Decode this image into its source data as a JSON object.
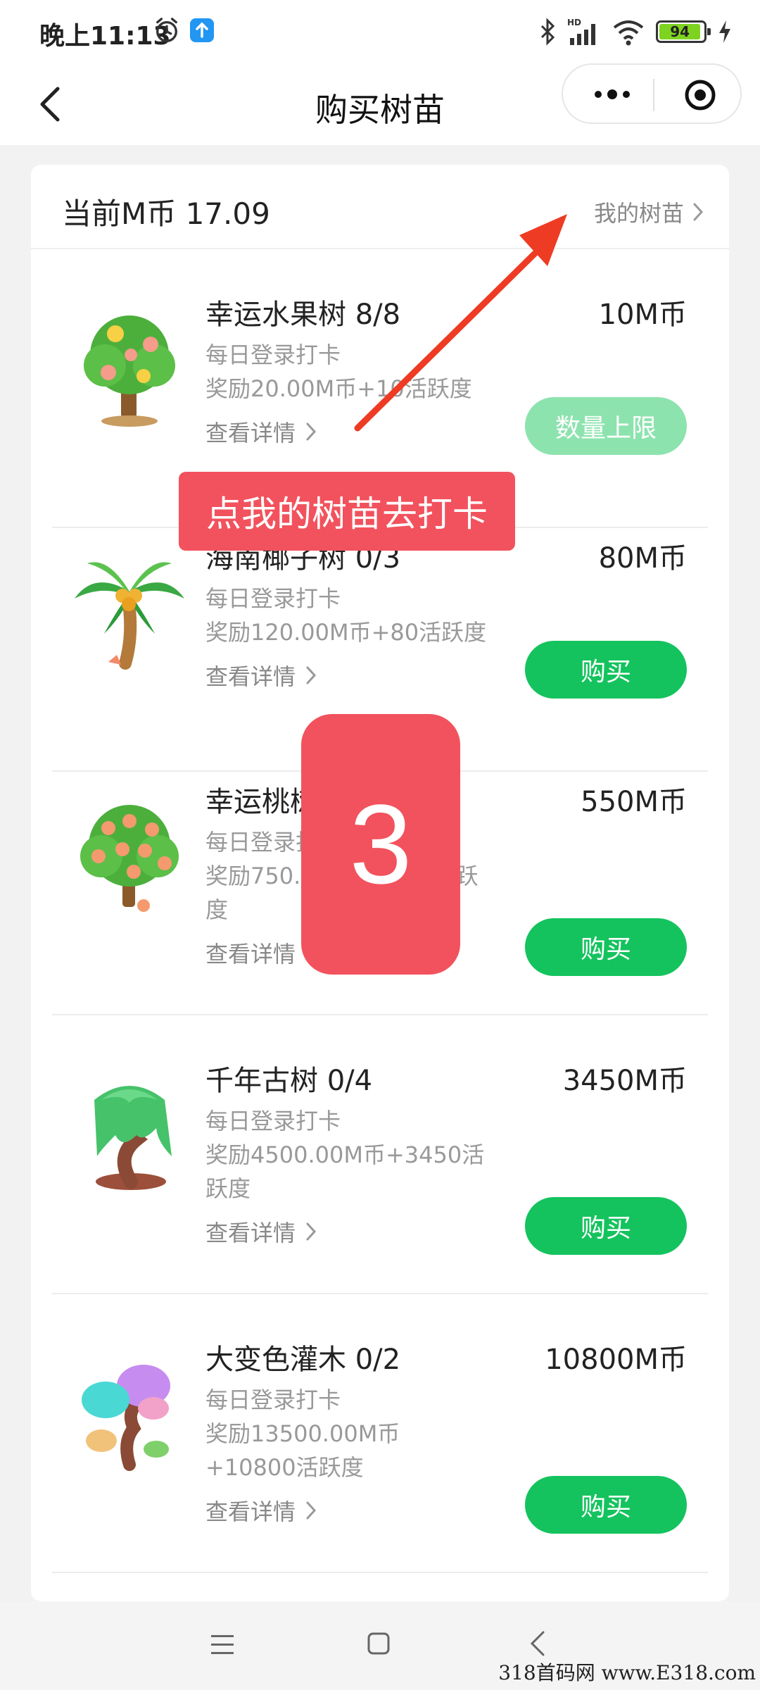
{
  "status_bar": {
    "time": "晚上11:13",
    "battery": "94",
    "network_label": "HD"
  },
  "nav": {
    "title": "购买树苗"
  },
  "header": {
    "balance": "当前M币 17.09",
    "my_trees_link": "我的树苗"
  },
  "items": [
    {
      "name": "幸运水果树 8/8",
      "price": "10M币",
      "desc_line1": "每日登录打卡",
      "desc_line2": "奖励20.00M币+10活跃度",
      "detail": "查看详情",
      "button": "数量上限",
      "disabled": true
    },
    {
      "name": "海南椰子树 0/3",
      "price": "80M币",
      "desc_line1": "每日登录打卡",
      "desc_line2": "奖励120.00M币+80活跃度",
      "detail": "查看详情",
      "button": "购买",
      "disabled": false
    },
    {
      "name": "幸运桃树 0/3",
      "price": "550M币",
      "desc_line1": "每日登录打卡",
      "desc_line2": "奖励750.00M币+550活跃度",
      "detail": "查看详情",
      "button": "购买",
      "disabled": false
    },
    {
      "name": "千年古树 0/4",
      "price": "3450M币",
      "desc_line1": "每日登录打卡",
      "desc_line2": "奖励4500.00M币+3450活跃度",
      "detail": "查看详情",
      "button": "购买",
      "disabled": false
    },
    {
      "name": "大变色灌木 0/2",
      "price": "10800M币",
      "desc_line1": "每日登录打卡",
      "desc_line2": "奖励13500.00M币+10800活跃度",
      "detail": "查看详情",
      "button": "购买",
      "disabled": false
    }
  ],
  "overlay": {
    "tip": "点我的树苗去打卡",
    "step": "3"
  },
  "watermark": "318首码网 www.E318.com"
}
